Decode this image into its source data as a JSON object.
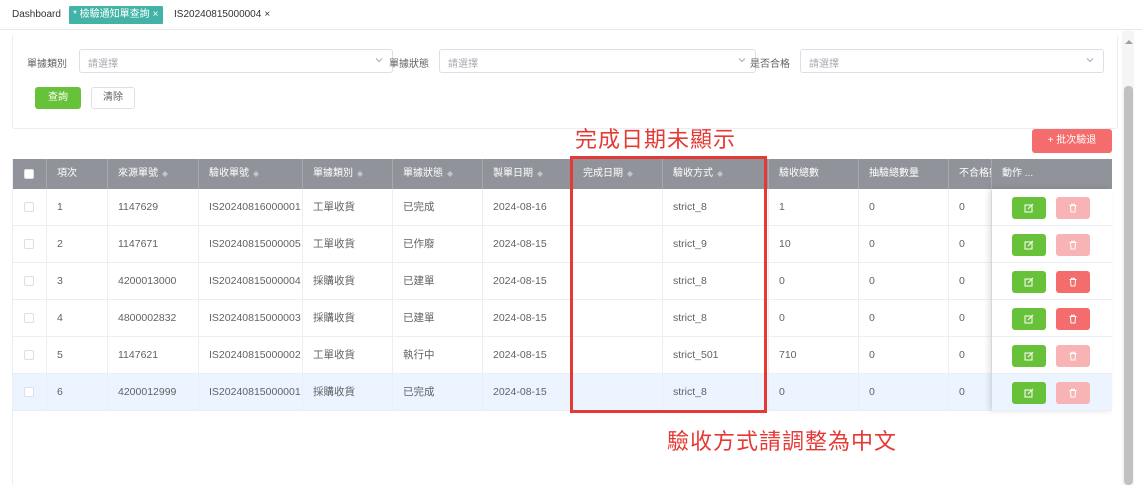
{
  "tabs": [
    {
      "label": "Dashboard"
    },
    {
      "label": "* 檢驗通知單查詢",
      "close": "×"
    },
    {
      "label": "IS20240815000004",
      "close": "×"
    }
  ],
  "filters": {
    "doc_type_label": "單據類別",
    "doc_status_label": "單據狀態",
    "pass_label": "是否合格",
    "placeholder": "請選擇",
    "query_button": "查詢",
    "clear_button": "清除"
  },
  "annotations": {
    "completion_date_note": "完成日期未顯示",
    "method_note": "驗收方式請調整為中文"
  },
  "batch_button": "+ 批次驗退",
  "table": {
    "columns": [
      "項次",
      "來源單號",
      "驗收單號",
      "單據類別",
      "單據狀態",
      "製單日期",
      "完成日期",
      "驗收方式",
      "驗收總數",
      "抽驗總數量",
      "不合格數",
      "動作 ..."
    ],
    "rows": [
      [
        "1",
        "1147629",
        "IS20240816000001",
        "工單收貨",
        "已完成",
        "2024-08-16",
        "",
        "strict_8",
        "1",
        "0",
        "0"
      ],
      [
        "2",
        "1147671",
        "IS20240815000005",
        "工單收貨",
        "已作廢",
        "2024-08-15",
        "",
        "strict_9",
        "10",
        "0",
        "0"
      ],
      [
        "3",
        "4200013000",
        "IS20240815000004",
        "採購收貨",
        "已建單",
        "2024-08-15",
        "",
        "strict_8",
        "0",
        "0",
        "0"
      ],
      [
        "4",
        "4800002832",
        "IS20240815000003",
        "採購收貨",
        "已建單",
        "2024-08-15",
        "",
        "strict_8",
        "0",
        "0",
        "0"
      ],
      [
        "5",
        "1147621",
        "IS20240815000002",
        "工單收貨",
        "執行中",
        "2024-08-15",
        "",
        "strict_501",
        "710",
        "0",
        "0"
      ],
      [
        "6",
        "4200012999",
        "IS20240815000001",
        "採購收貨",
        "已完成",
        "2024-08-15",
        "",
        "strict_8",
        "0",
        "0",
        "0"
      ]
    ],
    "delete_disabled": [
      true,
      true,
      false,
      false,
      true,
      true
    ]
  },
  "colors": {
    "accent": "#67c23a",
    "danger": "#f56c6c",
    "header": "#909399",
    "annotation": "#e53935",
    "tab_active": "#42b3a6"
  }
}
